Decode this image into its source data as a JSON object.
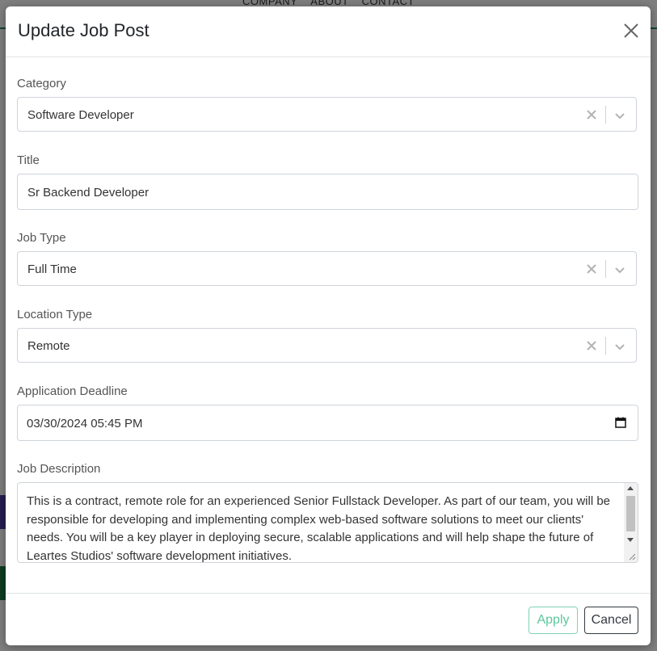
{
  "background": {
    "nav": [
      "COMPANY",
      "ABOUT",
      "CONTACT"
    ]
  },
  "modal": {
    "title": "Update Job Post",
    "fields": {
      "category": {
        "label": "Category",
        "value": "Software Developer"
      },
      "title": {
        "label": "Title",
        "value": "Sr Backend Developer"
      },
      "job_type": {
        "label": "Job Type",
        "value": "Full Time"
      },
      "location_type": {
        "label": "Location Type",
        "value": "Remote"
      },
      "deadline": {
        "label": "Application Deadline",
        "value": "03/30/2024 05:45 PM"
      },
      "description": {
        "label": "Job Description",
        "value": "This is a contract, remote role for an experienced Senior Fullstack Developer. As part of our team, you will be responsible for developing and implementing complex web-based software solutions to meet our clients' needs. You will be a key player in deploying secure, scalable applications and will help shape the future of Leartes Studios' software development initiatives."
      }
    },
    "footer": {
      "apply_label": "Apply",
      "cancel_label": "Cancel"
    }
  },
  "colors": {
    "apply_accent": "#5cc79e",
    "nav_accent": "#1f8a5a"
  }
}
